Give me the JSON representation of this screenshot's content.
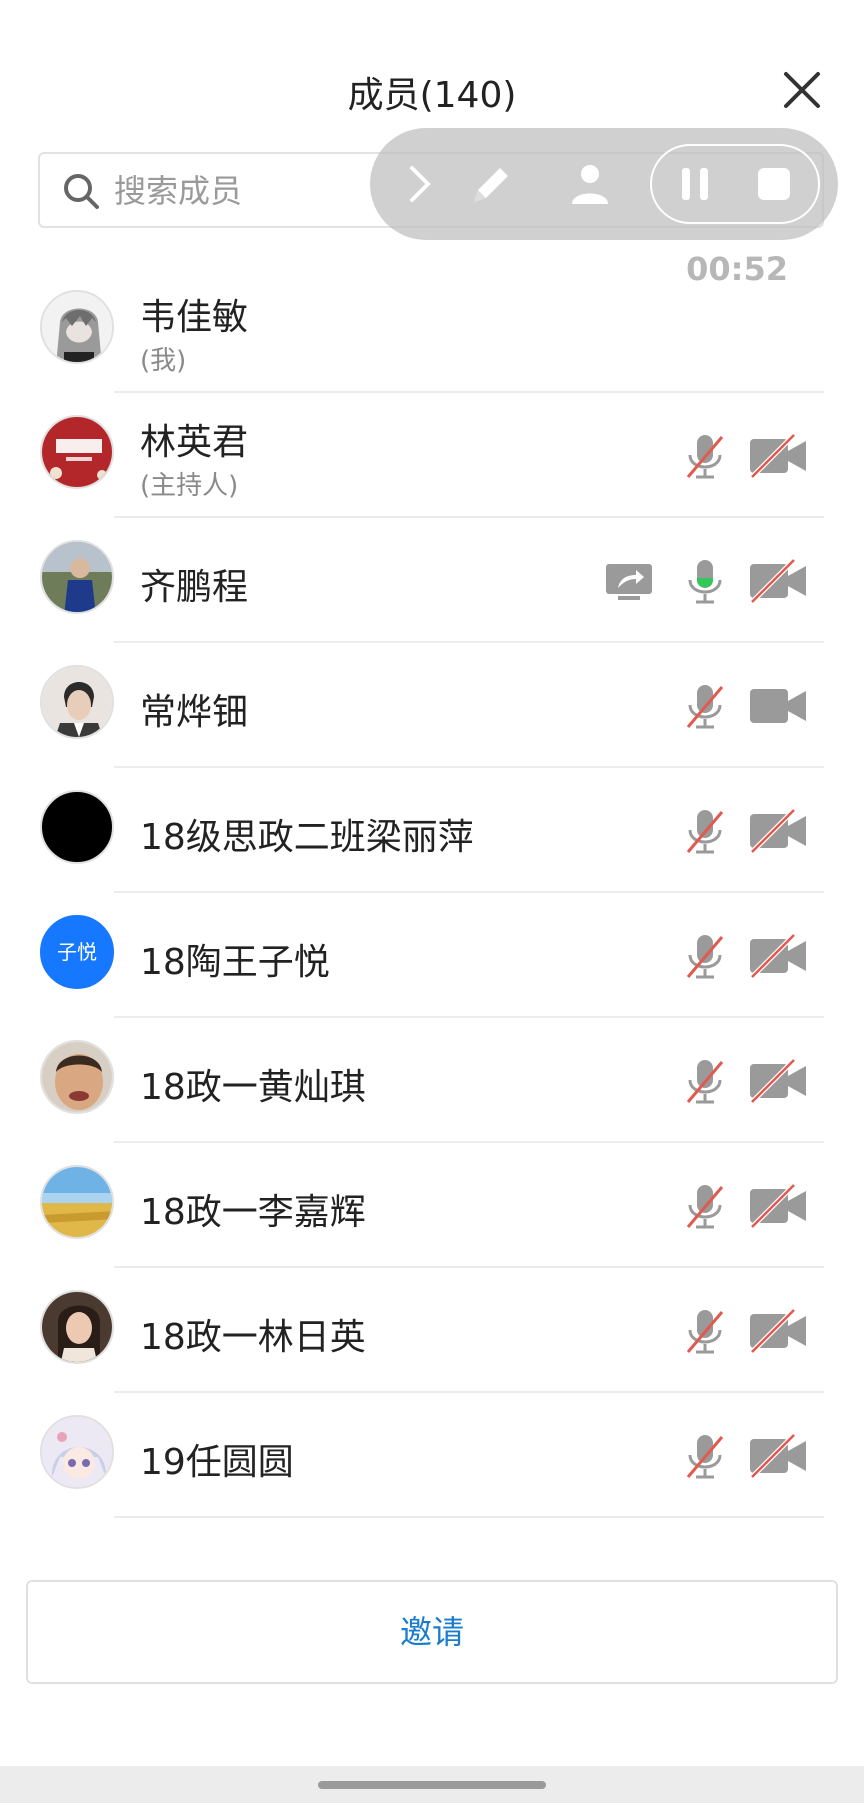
{
  "header": {
    "title": "成员(140)"
  },
  "search": {
    "placeholder": "搜索成员"
  },
  "recording": {
    "elapsed": "00:52"
  },
  "members": [
    {
      "name": "韦佳敏",
      "role": "(我)",
      "avatar": "anime-grey-hair",
      "mic": "none",
      "camera": "none"
    },
    {
      "name": "林英君",
      "role": "(主持人)",
      "avatar": "red-badge",
      "mic": "muted",
      "camera": "off"
    },
    {
      "name": "齐鹏程",
      "role": "",
      "avatar": "photo-boy",
      "screen_share": true,
      "mic": "on",
      "camera": "off"
    },
    {
      "name": "常烨钿",
      "role": "",
      "avatar": "photo-man",
      "mic": "muted",
      "camera": "on"
    },
    {
      "name": "18级思政二班梁丽萍",
      "role": "",
      "avatar": "black",
      "mic": "muted",
      "camera": "off"
    },
    {
      "name": "18陶王子悦",
      "role": "",
      "avatar": "text",
      "avatar_text": "子悦",
      "avatar_color": "#1677ff",
      "mic": "muted",
      "camera": "off"
    },
    {
      "name": "18政一黄灿琪",
      "role": "",
      "avatar": "photo-face",
      "mic": "muted",
      "camera": "off"
    },
    {
      "name": "18政一李嘉辉",
      "role": "",
      "avatar": "wheat-field",
      "mic": "muted",
      "camera": "off"
    },
    {
      "name": "18政一林日英",
      "role": "",
      "avatar": "photo-woman",
      "mic": "muted",
      "camera": "off"
    },
    {
      "name": "19任圆圆",
      "role": "",
      "avatar": "anime-girl",
      "mic": "muted",
      "camera": "off"
    }
  ],
  "footer": {
    "invite_label": "邀请"
  },
  "colors": {
    "accent": "#1a7ccc",
    "icon_grey": "#9a9a9a",
    "muted_red": "#e05a4f",
    "mic_active": "#34c759"
  }
}
